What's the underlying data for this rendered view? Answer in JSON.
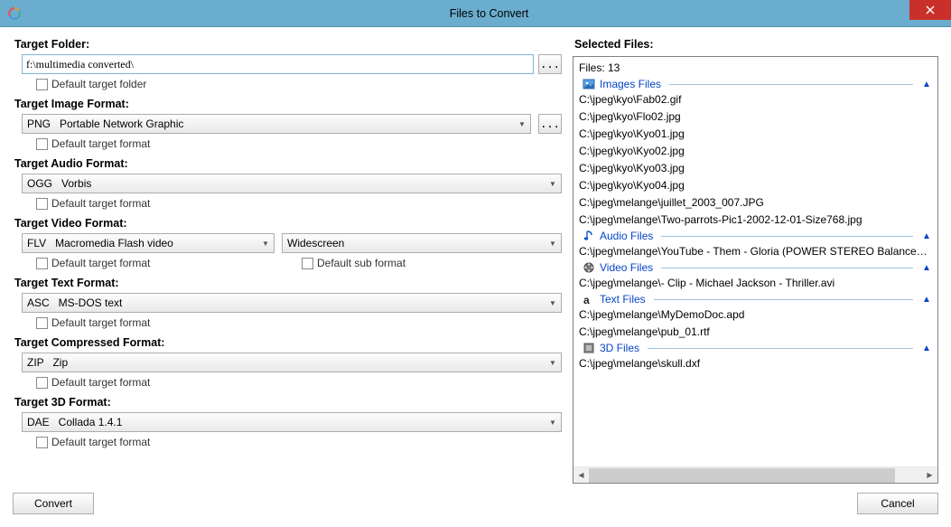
{
  "window": {
    "title": "Files to Convert"
  },
  "labels": {
    "target_folder": "Target Folder:",
    "target_image": "Target Image Format:",
    "target_audio": "Target Audio Format:",
    "target_video": "Target Video Format:",
    "target_text": "Target Text Format:",
    "target_compressed": "Target Compressed Format:",
    "target_3d": "Target 3D Format:",
    "selected_files": "Selected Files:"
  },
  "folder": {
    "path": "f:\\multimedia converted\\",
    "browse": "...",
    "default_cb": "Default target folder"
  },
  "image": {
    "value": "PNG   Portable Network Graphic",
    "browse": "...",
    "default_cb": "Default target format"
  },
  "audio": {
    "value": "OGG   Vorbis",
    "default_cb": "Default target format"
  },
  "video": {
    "value": "FLV   Macromedia Flash video",
    "sub_value": "Widescreen",
    "default_cb": "Default target format",
    "default_sub_cb": "Default sub format"
  },
  "text": {
    "value": "ASC   MS-DOS text",
    "default_cb": "Default target format"
  },
  "compressed": {
    "value": "ZIP   Zip",
    "default_cb": "Default target format"
  },
  "threeD": {
    "value": "DAE   Collada 1.4.1",
    "default_cb": "Default target format"
  },
  "files": {
    "count_line": "Files: 13",
    "cat_images": "Images Files",
    "cat_audio": "Audio Files",
    "cat_video": "Video Files",
    "cat_text": "Text Files",
    "cat_3d": "3D Files",
    "images": [
      "C:\\jpeg\\kyo\\Fab02.gif",
      "C:\\jpeg\\kyo\\Flo02.jpg",
      "C:\\jpeg\\kyo\\Kyo01.jpg",
      "C:\\jpeg\\kyo\\Kyo02.jpg",
      "C:\\jpeg\\kyo\\Kyo03.jpg",
      "C:\\jpeg\\kyo\\Kyo04.jpg",
      "C:\\jpeg\\melange\\juillet_2003_007.JPG",
      "C:\\jpeg\\melange\\Two-parrots-Pic1-2002-12-01-Size768.jpg"
    ],
    "audio": [
      "C:\\jpeg\\melange\\YouTube - Them - Gloria (POWER STEREO Balanced Re..."
    ],
    "video": [
      "C:\\jpeg\\melange\\- Clip - Michael Jackson - Thriller.avi"
    ],
    "text": [
      "C:\\jpeg\\melange\\MyDemoDoc.apd",
      "C:\\jpeg\\melange\\pub_01.rtf"
    ],
    "threeD": [
      "C:\\jpeg\\melange\\skull.dxf"
    ]
  },
  "buttons": {
    "convert": "Convert",
    "cancel": "Cancel"
  }
}
